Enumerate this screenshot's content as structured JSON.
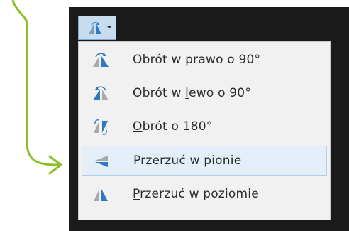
{
  "colors": {
    "accent_arrow": "#8dbf2c",
    "frame_background": "#1a1a1a",
    "button_background": "#c8dcf0",
    "menu_background": "#f1f1f1",
    "highlight_background": "#e4eef9",
    "icon_blue": "#2e78c4",
    "icon_light": "#a9a9a9"
  },
  "toolbar": {
    "rotate_button_icon": "rotate-icon",
    "dropdown_icon": "chevron-down-icon"
  },
  "menu": {
    "items": [
      {
        "before": "Obrót w p",
        "mnemonic": "r",
        "after": "awo o 90°",
        "icon": "rotate-right-icon",
        "highlighted": false
      },
      {
        "before": "Obrót w ",
        "mnemonic": "l",
        "after": "ewo o 90°",
        "icon": "rotate-left-icon",
        "highlighted": false
      },
      {
        "before": "",
        "mnemonic": "O",
        "after": "brót o 180°",
        "icon": "rotate-180-icon",
        "highlighted": false
      },
      {
        "before": "Przerzuć w pio",
        "mnemonic": "n",
        "after": "ie",
        "icon": "flip-vertical-icon",
        "highlighted": true
      },
      {
        "before": "",
        "mnemonic": "P",
        "after": "rzerzuć w poziomie",
        "icon": "flip-horizontal-icon",
        "highlighted": false
      }
    ]
  }
}
